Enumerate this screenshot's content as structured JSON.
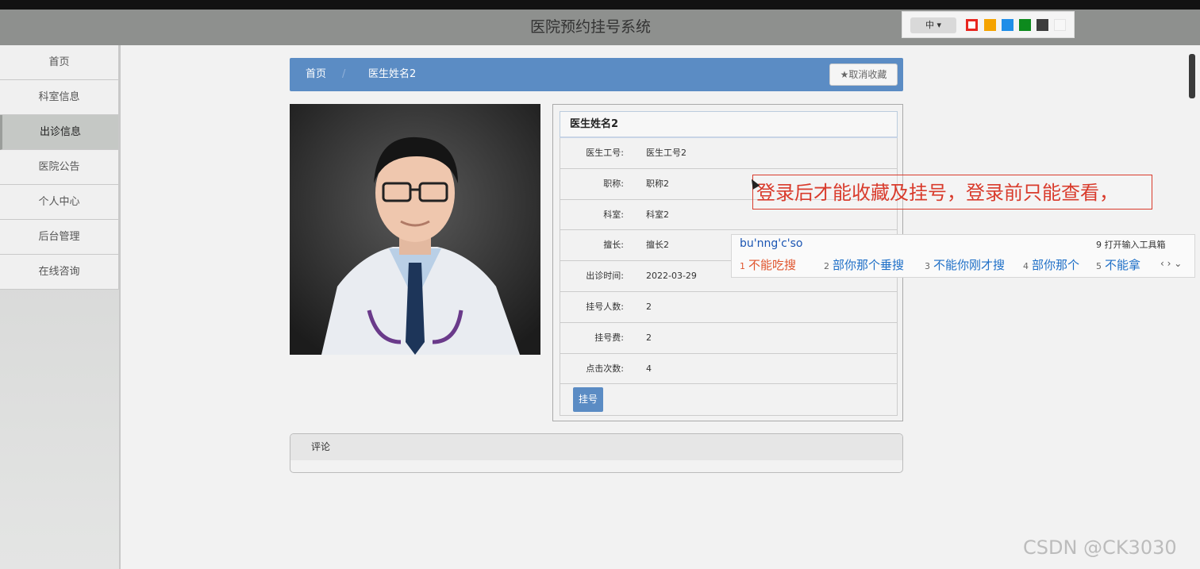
{
  "header": {
    "title": "医院预约挂号系统"
  },
  "theme": {
    "lang": "中 ▾",
    "colors": [
      "#e8261f",
      "#f5a300",
      "#1f8ee8",
      "#0d8a1d",
      "#3d3d3d",
      "#f7f7f7"
    ]
  },
  "sidebar": {
    "items": [
      {
        "label": "首页"
      },
      {
        "label": "科室信息"
      },
      {
        "label": "出诊信息"
      },
      {
        "label": "医院公告"
      },
      {
        "label": "个人中心"
      },
      {
        "label": "后台管理"
      },
      {
        "label": "在线咨询"
      }
    ],
    "active_index": 2
  },
  "breadcrumb": {
    "home": "首页",
    "separator": "/",
    "current": "医生姓名2"
  },
  "favorite_button": "★取消收藏",
  "doctor": {
    "name": "医生姓名2",
    "fields": [
      {
        "label": "医生工号:",
        "value": "医生工号2"
      },
      {
        "label": "职称:",
        "value": "职称2"
      },
      {
        "label": "科室:",
        "value": "科室2"
      },
      {
        "label": "擅长:",
        "value": "擅长2"
      },
      {
        "label": "出诊时间:",
        "value": "2022-03-29"
      },
      {
        "label": "挂号人数:",
        "value": "2"
      },
      {
        "label": "挂号费:",
        "value": "2"
      },
      {
        "label": "点击次数:",
        "value": "4"
      }
    ],
    "register_button": "挂号"
  },
  "comment": {
    "title": "评论"
  },
  "annotation": "登录后才能收藏及挂号，登录前只能查看，",
  "ime": {
    "pinyin": "bu'nng'c'so",
    "tools": "9 打开输入工具箱",
    "candidates": [
      {
        "num": "1",
        "text": "不能吃搜"
      },
      {
        "num": "2",
        "text": "部你那个垂搜"
      },
      {
        "num": "3",
        "text": "不能你刚才搜"
      },
      {
        "num": "4",
        "text": "部你那个"
      },
      {
        "num": "5",
        "text": "不能拿"
      }
    ],
    "nav": "‹ › ⌄"
  },
  "watermark": "CSDN @CK3030"
}
